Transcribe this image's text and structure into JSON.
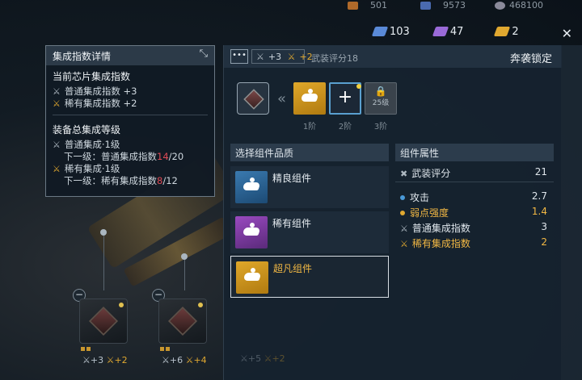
{
  "currencies_top": [
    {
      "icon": "ore-icon",
      "value": "501",
      "color": "#b06a2a"
    },
    {
      "icon": "crystal-icon",
      "value": "9573",
      "color": "#4a6ab0"
    },
    {
      "icon": "gear-coin-icon",
      "value": "468100",
      "color": "#8a8a9a"
    }
  ],
  "resources": [
    {
      "icon": "blue-cube-icon",
      "value": "103",
      "color": "#5a8ad8"
    },
    {
      "icon": "purple-cube-icon",
      "value": "47",
      "color": "#9a6ad8"
    },
    {
      "icon": "gold-cube-icon",
      "value": "2",
      "color": "#e0a830"
    }
  ],
  "tooltip": {
    "title": "集成指数详情",
    "current_section_title": "当前芯片集成指数",
    "current_lines": [
      {
        "label": "普通集成指数 +3",
        "type": "normal"
      },
      {
        "label": "稀有集成指数 +2",
        "type": "rare"
      }
    ],
    "total_section_title": "装备总集成等级",
    "normal_level": "普通集成·1级",
    "normal_next_prefix": "下一级：普通集成指数",
    "normal_next_current": "14",
    "normal_next_target": "/20",
    "rare_level": "稀有集成·1级",
    "rare_next_prefix": "下一级：稀有集成指数",
    "rare_next_current": "8",
    "rare_next_target": "/12"
  },
  "dialog": {
    "stats_normal": "+3",
    "stats_rare": "+2",
    "rating_label": "武装评分18",
    "lock_label": "奔袭锁定",
    "tiers": [
      {
        "label": "1阶",
        "state": "gold"
      },
      {
        "label": "2阶",
        "state": "add"
      },
      {
        "label": "3阶",
        "state": "locked",
        "lock_text": "25级"
      }
    ],
    "quality_header": "选择组件品质",
    "qualities": [
      {
        "label": "精良组件",
        "color": "blue"
      },
      {
        "label": "稀有组件",
        "color": "purple"
      },
      {
        "label": "超凡组件",
        "color": "gold",
        "selected": true
      }
    ],
    "attr_header": "组件属性",
    "attr_score_label": "武装评分",
    "attr_score_value": "21",
    "attributes": [
      {
        "label": "攻击",
        "value": "2.7",
        "style": "blue-dot"
      },
      {
        "label": "弱点强度",
        "value": "1.4",
        "style": "gold-dot"
      },
      {
        "label": "普通集成指数",
        "value": "3",
        "style": "x"
      },
      {
        "label": "稀有集成指数",
        "value": "2",
        "style": "x-gold"
      }
    ]
  },
  "slots": [
    {
      "normal": "+3",
      "rare": "+2"
    },
    {
      "normal": "+6",
      "rare": "+4"
    }
  ],
  "bg_slot3": {
    "normal": "+5",
    "rare": "+2"
  }
}
